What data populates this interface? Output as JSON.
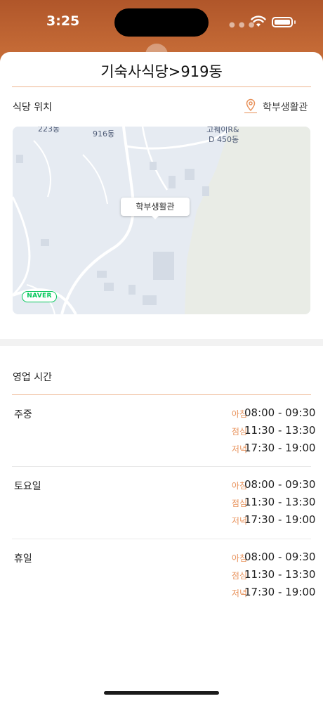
{
  "status_bar": {
    "time": "3:25"
  },
  "sheet": {
    "title": "기숙사식당>919동"
  },
  "location": {
    "label": "식당 위치",
    "value": "학부생활관",
    "map": {
      "marker_label": "학부생활관",
      "labels": [
        "223동",
        "916동",
        "고꿰이R&",
        "D 450동"
      ],
      "provider_logo": "NAVER"
    }
  },
  "hours": {
    "label": "영업 시간",
    "days": [
      {
        "name": "주중",
        "meals": [
          {
            "label": "아침",
            "time": "08:00 - 09:30"
          },
          {
            "label": "점심",
            "time": "11:30 - 13:30"
          },
          {
            "label": "저녁",
            "time": "17:30 - 19:00"
          }
        ]
      },
      {
        "name": "토요일",
        "meals": [
          {
            "label": "아침",
            "time": "08:00 - 09:30"
          },
          {
            "label": "점심",
            "time": "11:30 - 13:30"
          },
          {
            "label": "저녁",
            "time": "17:30 - 19:00"
          }
        ]
      },
      {
        "name": "휴일",
        "meals": [
          {
            "label": "아침",
            "time": "08:00 - 09:30"
          },
          {
            "label": "점심",
            "time": "11:30 - 13:30"
          },
          {
            "label": "저녁",
            "time": "17:30 - 19:00"
          }
        ]
      }
    ]
  },
  "colors": {
    "accent": "#e8925b",
    "header_bg": "#c46a36",
    "naver_green": "#03c75a"
  },
  "icons": [
    "wifi-icon",
    "battery-icon",
    "location-pin-icon"
  ]
}
